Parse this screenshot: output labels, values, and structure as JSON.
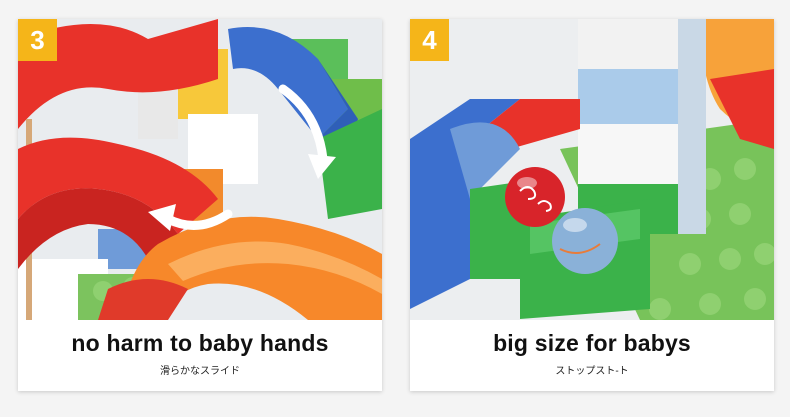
{
  "panels": [
    {
      "number": "3",
      "title": "no harm to baby hands",
      "subtitle": "滑らかなスライド",
      "image_description": "red and orange plastic marble-run slides with white curved arrows"
    },
    {
      "number": "4",
      "title": "big size for babys",
      "subtitle": "ストップスト-ト",
      "image_description": "red and blue marbles resting in a green block stop"
    }
  ],
  "colors": {
    "badge": "#f5b519",
    "slide_red": "#e8322a",
    "slide_orange": "#f7882a",
    "block_blue": "#3c6fce",
    "block_green": "#3bb24a",
    "base_green": "#78c35a"
  }
}
